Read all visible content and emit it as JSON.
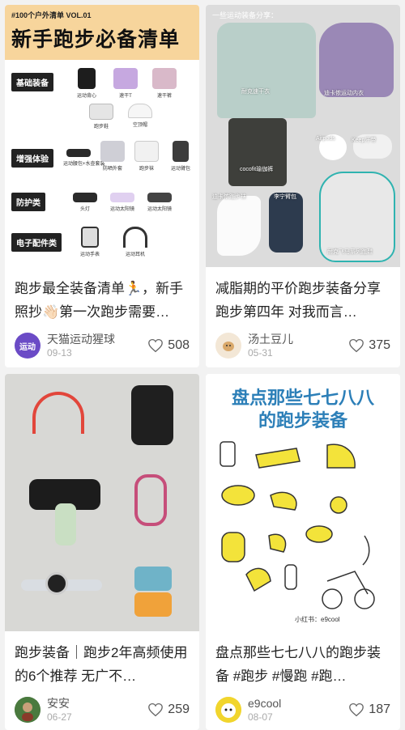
{
  "feed": {
    "cards": [
      {
        "title": "跑步最全装备清单🏃，新手照抄👋🏻第一次跑步需要…",
        "author": "天猫运动猩球",
        "date": "09-13",
        "likes": "508",
        "avatar_text": "运动",
        "cover": {
          "small_title": "#100个户外清单 VOL.01",
          "big_title": "新手跑步必备清单",
          "rows": [
            {
              "tag": "基础装备",
              "items": [
                "运动背心",
                "速干T",
                "速干裤"
              ],
              "items2": [
                "跑步鞋",
                "空顶帽"
              ]
            },
            {
              "tag": "增强体验",
              "items": [
                "运动腰包+水壶套装",
                "防晒外套",
                "跑步袜",
                "运动臂包"
              ]
            },
            {
              "tag": "防护类",
              "items": [
                "头灯",
                "运动太阳镜",
                "运动太阳镜"
              ]
            },
            {
              "tag": "电子配件类",
              "items": [
                "运动手表",
                "运动耳机"
              ]
            }
          ]
        }
      },
      {
        "title": "减脂期的平价跑步装备分享 跑步第四年 对我而言…",
        "author": "汤土豆儿",
        "date": "05-31",
        "likes": "375",
        "cover": {
          "top_label": "一些运动装备分享：",
          "labels": {
            "tee": "耐克速干衣",
            "bra": "迪卡侬运动内衣",
            "shorts": "cocofit瑜伽裤",
            "pods": "Airpods",
            "keep": "Keep汗带",
            "socks": "迪卡侬跑步袜",
            "armband": "李宁臂包",
            "shoes": "耐克飞马系列跑鞋"
          }
        }
      },
      {
        "title": "跑步装备｜跑步2年高频使用的6个推荐 无广不…",
        "author": "安安",
        "date": "06-27",
        "likes": "259"
      },
      {
        "title": "盘点那些七七八八的跑步装备 #跑步 #慢跑 #跑…",
        "author": "e9cool",
        "date": "08-07",
        "likes": "187",
        "cover": {
          "title_line1": "盘点那些七七八八",
          "title_line2": "的跑步装备",
          "signature": "小红书：e9cool"
        }
      }
    ]
  },
  "colors": {
    "checklist_header": "#f7d59c",
    "illustration_blue": "#2c7fb8",
    "illustration_yellow": "#f3e33a"
  }
}
